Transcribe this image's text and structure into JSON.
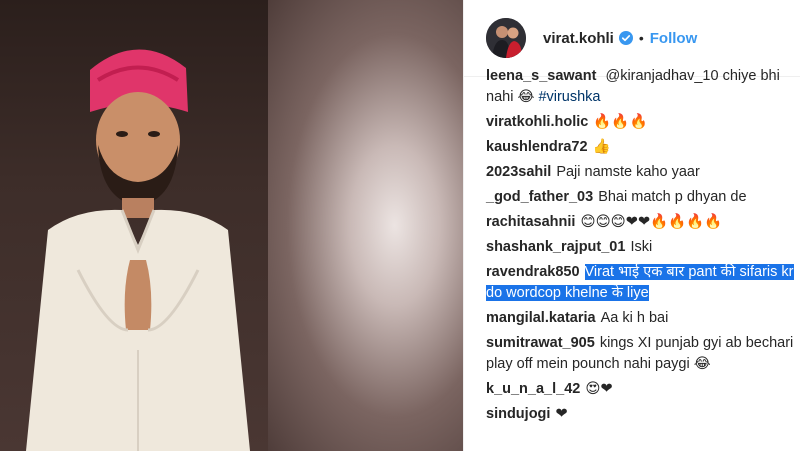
{
  "header": {
    "username": "virat.kohli",
    "separator": "•",
    "follow_label": "Follow"
  },
  "comments": [
    {
      "user": "leena_s_sawant",
      "text_parts": [
        "@kiranjadhav_10 chiye bhi nahi",
        "😂",
        " "
      ],
      "tag": "#virushka"
    },
    {
      "user": "viratkohli.holic",
      "text": "🔥🔥🔥"
    },
    {
      "user": "kaushlendra72",
      "text": "👍"
    },
    {
      "user": "2023sahil",
      "text": "Paji namste kaho yaar"
    },
    {
      "user": "_god_father_03",
      "text": "Bhai match p dhyan de"
    },
    {
      "user": "rachitasahnii",
      "text": "😊😊😊❤❤🔥🔥🔥🔥"
    },
    {
      "user": "shashank_rajput_01",
      "text": "Iski"
    },
    {
      "user": "ravendrak850",
      "highlighted": "Virat भाई एक बार pant की sifaris kr do wordcop khelne के liye"
    },
    {
      "user": "mangilal.kataria",
      "text": "Aa ki h bai"
    },
    {
      "user": "sumitrawat_905",
      "text": "kings XI punjab gyi ab bechari play off mein pounch nahi paygi 😂"
    },
    {
      "user": "k_u_n_a_l_42",
      "text": "😍❤"
    },
    {
      "user": "sindujogi",
      "text": "❤"
    }
  ],
  "colors": {
    "follow": "#3897f0",
    "verified": "#3897f0",
    "highlight": "#1a73e8",
    "text": "#262626"
  },
  "icons": {
    "verified": "verified-badge-icon"
  }
}
